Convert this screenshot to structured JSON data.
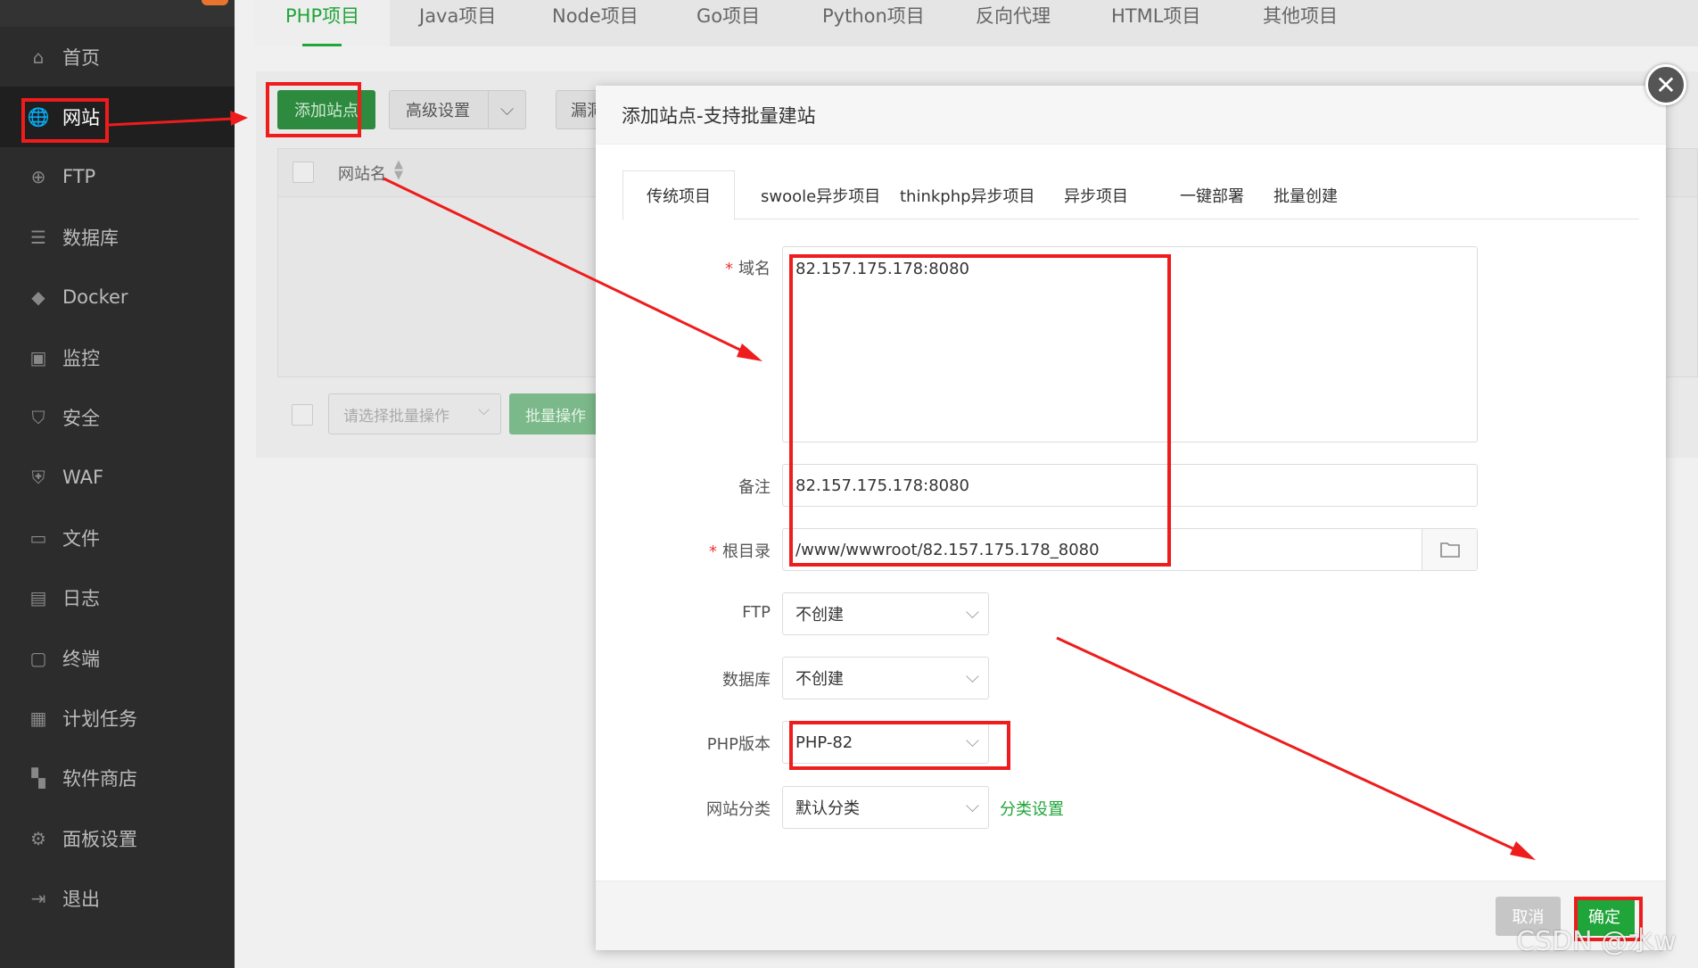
{
  "sidebar": {
    "items": [
      {
        "label": "首页",
        "icon": "home-icon",
        "glyph": "⌂"
      },
      {
        "label": "网站",
        "icon": "globe-icon",
        "glyph": "🌐"
      },
      {
        "label": "FTP",
        "icon": "ftp-icon",
        "glyph": "⊕"
      },
      {
        "label": "数据库",
        "icon": "database-icon",
        "glyph": "☰"
      },
      {
        "label": "Docker",
        "icon": "docker-icon",
        "glyph": "◆"
      },
      {
        "label": "监控",
        "icon": "monitor-icon",
        "glyph": "▣"
      },
      {
        "label": "安全",
        "icon": "shield-icon",
        "glyph": "⛉"
      },
      {
        "label": "WAF",
        "icon": "waf-icon",
        "glyph": "⛨"
      },
      {
        "label": "文件",
        "icon": "folder-icon",
        "glyph": "▭"
      },
      {
        "label": "日志",
        "icon": "log-icon",
        "glyph": "▤"
      },
      {
        "label": "终端",
        "icon": "terminal-icon",
        "glyph": "▢"
      },
      {
        "label": "计划任务",
        "icon": "calendar-icon",
        "glyph": "▦"
      },
      {
        "label": "软件商店",
        "icon": "apps-icon",
        "glyph": "▚"
      },
      {
        "label": "面板设置",
        "icon": "gear-icon",
        "glyph": "⚙"
      },
      {
        "label": "退出",
        "icon": "logout-icon",
        "glyph": "⇥"
      }
    ]
  },
  "top_tabs": [
    "PHP项目",
    "Java项目",
    "Node项目",
    "Go项目",
    "Python项目",
    "反向代理",
    "HTML项目",
    "其他项目"
  ],
  "toolbar": {
    "add_site": "添加站点",
    "advanced": "高级设置",
    "leak": "漏洞扫描"
  },
  "table": {
    "col_site_name": "网站名"
  },
  "bulk": {
    "select_placeholder": "请选择批量操作",
    "button": "批量操作"
  },
  "modal": {
    "title": "添加站点-支持批量建站",
    "tabs": [
      "传统项目",
      "swoole异步项目",
      "thinkphp异步项目",
      "异步项目",
      "一键部署",
      "批量创建"
    ],
    "fields": {
      "domain_label": "域名",
      "domain_value": "82.157.175.178:8080",
      "remark_label": "备注",
      "remark_value": "82.157.175.178:8080",
      "root_label": "根目录",
      "root_value": "/www/wwwroot/82.157.175.178_8080",
      "ftp_label": "FTP",
      "ftp_value": "不创建",
      "db_label": "数据库",
      "db_value": "不创建",
      "php_label": "PHP版本",
      "php_value": "PHP-82",
      "category_label": "网站分类",
      "category_value": "默认分类",
      "category_link": "分类设置"
    },
    "cancel": "取消",
    "ok": "确定"
  },
  "watermark": "CSDN @水w",
  "colors": {
    "accent": "#20a53a",
    "annotation": "#ee1c1c",
    "sidebar_bg": "#2c2c2c"
  }
}
